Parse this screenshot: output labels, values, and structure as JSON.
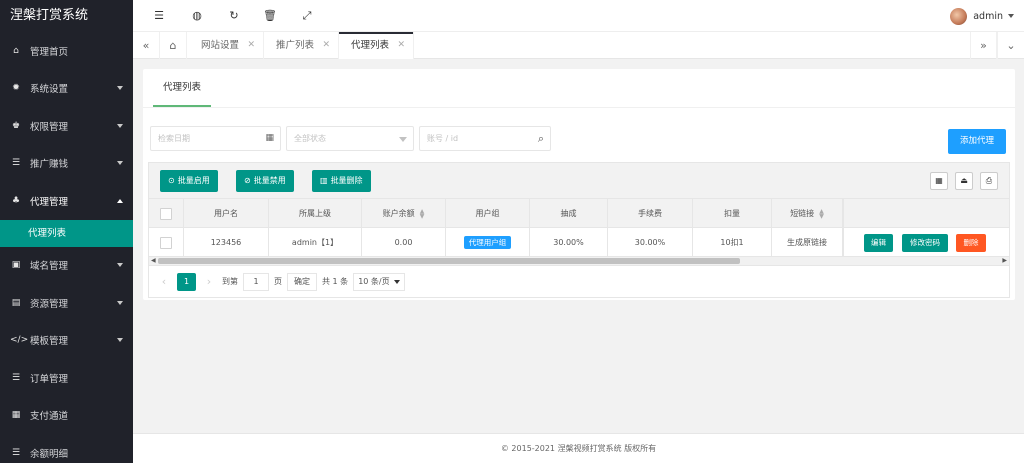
{
  "app": {
    "title": "涅槃打赏系统"
  },
  "sidebar": {
    "items": [
      {
        "label": "管理首页",
        "icon": "home-icon"
      },
      {
        "label": "系统设置",
        "icon": "gear-icon"
      },
      {
        "label": "权限管理",
        "icon": "users-icon"
      },
      {
        "label": "推广赚钱",
        "icon": "list-icon"
      },
      {
        "label": "代理管理",
        "icon": "user-group-icon"
      },
      {
        "label": "域名管理",
        "icon": "domain-icon"
      },
      {
        "label": "资源管理",
        "icon": "file-icon"
      },
      {
        "label": "模板管理",
        "icon": "code-icon"
      },
      {
        "label": "订单管理",
        "icon": "list-icon"
      },
      {
        "label": "支付通道",
        "icon": "grid-icon"
      },
      {
        "label": "余额明细",
        "icon": "list-icon"
      }
    ],
    "sub_active": "代理列表"
  },
  "header": {
    "user": "admin"
  },
  "tabs": [
    {
      "label": "网站设置"
    },
    {
      "label": "推广列表"
    },
    {
      "label": "代理列表",
      "active": true
    }
  ],
  "card": {
    "tab": "代理列表"
  },
  "filters": {
    "date_placeholder": "检索日期",
    "status_placeholder": "全部状态",
    "account_placeholder": "账号 / id"
  },
  "actions": {
    "add": "添加代理",
    "batch_enable": "批量启用",
    "batch_disable": "批量禁用",
    "batch_delete": "批量删除"
  },
  "table": {
    "headers": [
      "用户名",
      "所属上级",
      "账户余额",
      "用户组",
      "抽成",
      "手续费",
      "扣量",
      "短链接"
    ],
    "rows": [
      {
        "username": "123456",
        "parent": "admin【1】",
        "balance": "0.00",
        "group": "代理用户组",
        "commission": "30.00%",
        "fee": "30.00%",
        "deduct": "10扣1",
        "shortlink": "生成原链接",
        "edit": "编辑",
        "change_password": "修改密码",
        "delete": "删除"
      }
    ]
  },
  "pager": {
    "current": "1",
    "goto": "到第",
    "page_value": "1",
    "page_unit": "页",
    "confirm": "确定",
    "total": "共 1 条",
    "per_page": "10 条/页"
  },
  "footer": {
    "text": "© 2015-2021 涅槃视频打赏系统 版权所有"
  },
  "colors": {
    "sidebar": "#20222a",
    "accent": "#009688",
    "blue": "#1e9fff",
    "danger": "#ff5722"
  }
}
